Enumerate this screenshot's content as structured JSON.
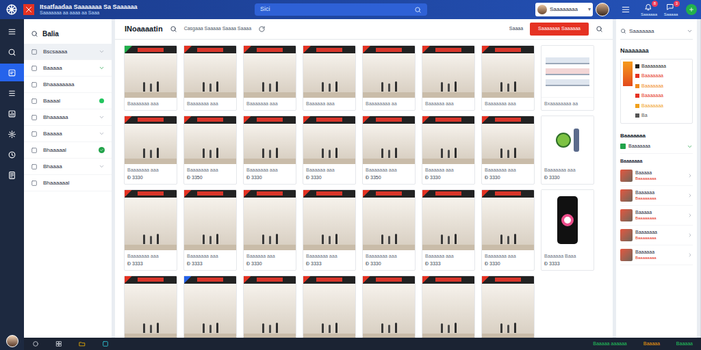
{
  "app": {
    "title": "Itsatfaadaa Saaaaaaa Sa Saaaaaa",
    "subtitle": "Saaaaaaa aa aaaa aa Saaa",
    "search_placeholder": "Sici"
  },
  "user": {
    "name": "Saaaaaaaa",
    "caret": "▾"
  },
  "header_icons": [
    {
      "label": "Saaaaaa",
      "badge": "8"
    },
    {
      "label": "Saaaaa",
      "badge": "3"
    }
  ],
  "rail": [
    {
      "selected": false
    },
    {
      "selected": false
    },
    {
      "selected": true
    },
    {
      "selected": false
    },
    {
      "selected": false
    },
    {
      "selected": false
    },
    {
      "selected": false
    },
    {
      "selected": false
    }
  ],
  "sidebar": {
    "title": "Balia",
    "items": [
      {
        "label": "Bscsaaaa",
        "selected": true,
        "marker": "chevron",
        "color": "#9ca3af"
      },
      {
        "label": "Baaaaa",
        "selected": false,
        "marker": "chevron",
        "color": "#22a34a"
      },
      {
        "label": "Bhaaaaaaaa",
        "selected": false,
        "marker": "none"
      },
      {
        "label": "Baaaal",
        "selected": false,
        "marker": "dot",
        "color": "#22c55e"
      },
      {
        "label": "Bhaaaaaa",
        "selected": false,
        "marker": "chevron",
        "color": "#9ca3af"
      },
      {
        "label": "Baaaaa",
        "selected": false,
        "marker": "chevron",
        "color": "#9ca3af"
      },
      {
        "label": "Bhaaaaal",
        "selected": false,
        "marker": "badge",
        "color": "#22a34a"
      },
      {
        "label": "Bhaaaa",
        "selected": false,
        "marker": "chevron",
        "color": "#9ca3af"
      },
      {
        "label": "Bhaaaaaal",
        "selected": false,
        "marker": "none"
      }
    ]
  },
  "main": {
    "title": "INoaaaatin",
    "filter": "Casgaaa Saaaaa Saaaa Saaaa",
    "sort_label": "Saaaa",
    "action_button": "Saaaaaaa Saaaaaa"
  },
  "cards": [
    [
      {
        "kind": "photo",
        "color": "#22b14c",
        "label": "Baaaaaaa aaa"
      },
      {
        "kind": "photo",
        "color": "#e53222",
        "label": "Baaaaaaa aaa"
      },
      {
        "kind": "photo",
        "color": "#e53222",
        "label": "Baaaaaaa aaa"
      },
      {
        "kind": "photo",
        "color": "#e53222",
        "label": "Baaaaaa aaa"
      },
      {
        "kind": "photo",
        "color": "#e53222",
        "label": "Baaaaaaaa aa"
      },
      {
        "kind": "photo",
        "color": "#e53222",
        "label": "Baaaaaa aaa"
      },
      {
        "kind": "photo",
        "color": "#e53222",
        "label": "Baaaaaaa aaa"
      },
      {
        "kind": "shelf",
        "label": "Bxaaaaaaaa aa"
      }
    ],
    [
      {
        "kind": "photo",
        "color": "#e53222",
        "label": "Baaaaaaa aaa",
        "price": "Đ 3330"
      },
      {
        "kind": "photo",
        "color": "#e53222",
        "label": "Baaaaaaa aaa",
        "price": "Đ 3350"
      },
      {
        "kind": "photo",
        "color": "#e53222",
        "label": "Baaaaaaa aaa",
        "price": "Đ 3330"
      },
      {
        "kind": "photo",
        "color": "#e53222",
        "label": "Baaaaaa aaa",
        "price": "Đ 3330"
      },
      {
        "kind": "photo",
        "color": "#e53222",
        "label": "Baaaaaaa aaa",
        "price": "Đ 3350"
      },
      {
        "kind": "photo",
        "color": "#e53222",
        "label": "Baaaaaa aaa",
        "price": "Đ 3330"
      },
      {
        "kind": "photo",
        "color": "#e53222",
        "label": "Baaaaaaa aaa",
        "price": "Đ 3330"
      },
      {
        "kind": "figure",
        "label": "Baaaaaaa aaa",
        "price": "Đ 3330"
      }
    ],
    [
      {
        "kind": "photo",
        "color": "#e53222",
        "label": "Baaaaaaa aaa",
        "price": "Đ 3333"
      },
      {
        "kind": "photo",
        "color": "#e53222",
        "label": "Baaaaaaa aaa",
        "price": "Đ 3333"
      },
      {
        "kind": "photo",
        "color": "#e53222",
        "label": "Baaaaaa aaa",
        "price": "Đ 3330"
      },
      {
        "kind": "photo",
        "color": "#e53222",
        "label": "Baaaaaaa aaa",
        "price": "Đ 3333"
      },
      {
        "kind": "photo",
        "color": "#e53222",
        "label": "Baaaaaaa aaa",
        "price": "Đ 3330"
      },
      {
        "kind": "photo",
        "color": "#e53222",
        "label": "Baaaaaa aaa",
        "price": "Đ 3333"
      },
      {
        "kind": "photo",
        "color": "#e53222",
        "label": "Baaaaaaa aaa",
        "price": "Đ 3330"
      },
      {
        "kind": "phone",
        "label": "Baaaaaa Baaa",
        "price": "Đ 3333"
      }
    ],
    [
      {
        "kind": "photo",
        "color": "#e53222"
      },
      {
        "kind": "photo",
        "color": "#2563eb"
      },
      {
        "kind": "photo",
        "color": "#e53222"
      },
      {
        "kind": "photo",
        "color": "#e53222"
      },
      {
        "kind": "photo",
        "color": "#e53222"
      },
      {
        "kind": "photo",
        "color": "#e53222"
      },
      {
        "kind": "photo",
        "color": "#e53222"
      }
    ]
  ],
  "right_panel": {
    "dropdown": "Saaaaaaa",
    "heading": "Naaaaaaa",
    "summary": [
      {
        "label": "Baaaaaaaa",
        "color": "#222222"
      },
      {
        "label": "Baaaaaaa",
        "color": "#e53222"
      },
      {
        "label": "Baaaaaaa",
        "color": "#f08a1c"
      },
      {
        "label": "Baaaaaaa",
        "color": "#e53222"
      },
      {
        "label": "Baaaaaaa",
        "color": "#f0a01c"
      },
      {
        "label": "Ba",
        "color": "#555555"
      }
    ],
    "section": "Baaaaaaa",
    "section_item": "Baaaaaaa",
    "list_heading": "Baaaaaaa",
    "list": [
      {
        "title": "Baaaaa",
        "sub": "Baaaaaaaa"
      },
      {
        "title": "Baaaaaa",
        "sub": "Baaaaaaaa"
      },
      {
        "title": "Baaaaa",
        "sub": "Baaaaaaaa"
      },
      {
        "title": "Baaaaaaa",
        "sub": "Baaaaaaaa"
      },
      {
        "title": "Baaaaaa",
        "sub": "Baaaaaaaa"
      }
    ]
  },
  "status_bar": [
    {
      "label": "Baaaaa aaaaaa",
      "color": "#22c55e"
    },
    {
      "label": "Baaaaa",
      "color": "#f59e0b"
    },
    {
      "label": "Baaaaa",
      "color": "#22c55e"
    }
  ]
}
